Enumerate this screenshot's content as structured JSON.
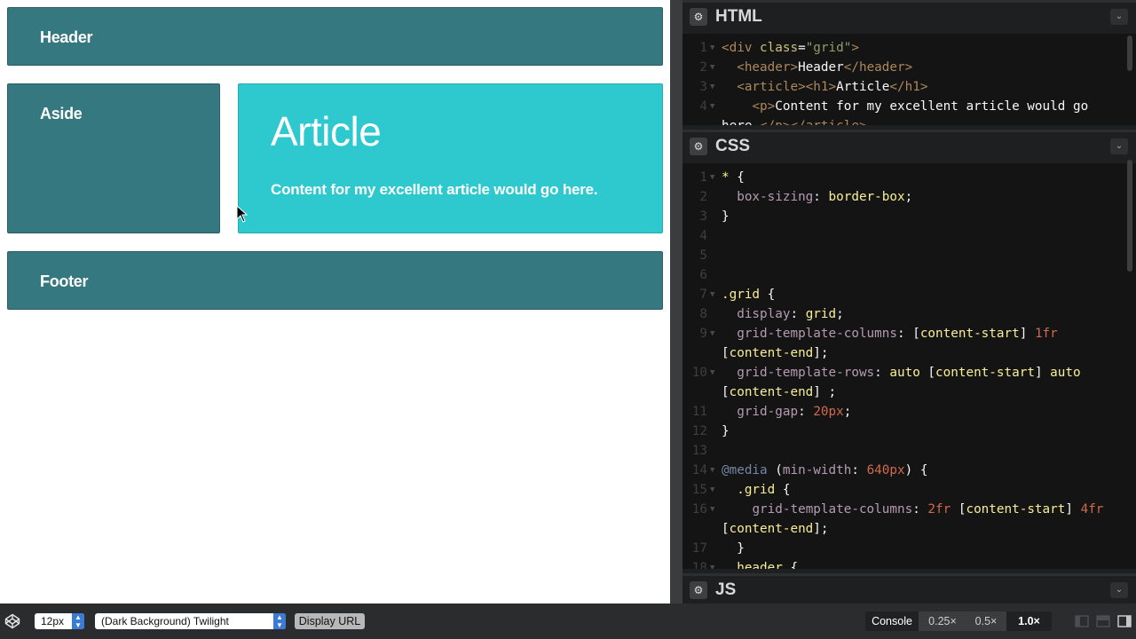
{
  "preview": {
    "header": "Header",
    "aside": "Aside",
    "article_title": "Article",
    "article_text": "Content for my excellent article would go here.",
    "footer": "Footer"
  },
  "editors": {
    "html": {
      "title": "HTML"
    },
    "css": {
      "title": "CSS"
    },
    "js": {
      "title": "JS"
    }
  },
  "html_code": [
    {
      "n": "1",
      "fold": true,
      "parts": [
        [
          "tag",
          "<div "
        ],
        [
          "atn",
          "class"
        ],
        [
          "pun",
          "="
        ],
        [
          "str",
          "\"grid\""
        ],
        [
          "tag",
          ">"
        ]
      ]
    },
    {
      "n": "2",
      "fold": true,
      "parts": [
        [
          "txt",
          "  "
        ],
        [
          "tag",
          "<header>"
        ],
        [
          "txt",
          "Header"
        ],
        [
          "tag",
          "</header>"
        ]
      ]
    },
    {
      "n": "3",
      "fold": true,
      "parts": [
        [
          "txt",
          "  "
        ],
        [
          "tag",
          "<article><h1>"
        ],
        [
          "txt",
          "Article"
        ],
        [
          "tag",
          "</h1>"
        ]
      ]
    },
    {
      "n": "4",
      "fold": true,
      "parts": [
        [
          "txt",
          "    "
        ],
        [
          "tag",
          "<p>"
        ],
        [
          "txt",
          "Content for my excellent article would go"
        ]
      ]
    },
    {
      "n": "",
      "fold": false,
      "parts": [
        [
          "txt",
          "here."
        ],
        [
          "tag",
          "</p></article>"
        ]
      ]
    }
  ],
  "css_code": [
    {
      "n": "1",
      "fold": true,
      "parts": [
        [
          "sel",
          "* "
        ],
        [
          "pun",
          "{"
        ]
      ]
    },
    {
      "n": "2",
      "fold": false,
      "parts": [
        [
          "txt",
          "  "
        ],
        [
          "prop",
          "box-sizing"
        ],
        [
          "pun",
          ": "
        ],
        [
          "val",
          "border-box"
        ],
        [
          "pun",
          ";"
        ]
      ]
    },
    {
      "n": "3",
      "fold": false,
      "parts": [
        [
          "pun",
          "}"
        ]
      ]
    },
    {
      "n": "4",
      "fold": false,
      "parts": []
    },
    {
      "n": "5",
      "fold": false,
      "parts": []
    },
    {
      "n": "6",
      "fold": false,
      "parts": []
    },
    {
      "n": "7",
      "fold": true,
      "parts": [
        [
          "sel",
          ".grid "
        ],
        [
          "pun",
          "{"
        ]
      ]
    },
    {
      "n": "8",
      "fold": false,
      "parts": [
        [
          "txt",
          "  "
        ],
        [
          "prop",
          "display"
        ],
        [
          "pun",
          ": "
        ],
        [
          "val",
          "grid"
        ],
        [
          "pun",
          ";"
        ]
      ]
    },
    {
      "n": "9",
      "fold": true,
      "parts": [
        [
          "txt",
          "  "
        ],
        [
          "prop",
          "grid-template-columns"
        ],
        [
          "pun",
          ": ["
        ],
        [
          "val",
          "content-start"
        ],
        [
          "pun",
          "] "
        ],
        [
          "num",
          "1fr"
        ]
      ]
    },
    {
      "n": "",
      "fold": false,
      "parts": [
        [
          "pun",
          "["
        ],
        [
          "val",
          "content-end"
        ],
        [
          "pun",
          "];"
        ]
      ]
    },
    {
      "n": "10",
      "fold": true,
      "parts": [
        [
          "txt",
          "  "
        ],
        [
          "prop",
          "grid-template-rows"
        ],
        [
          "pun",
          ": "
        ],
        [
          "val",
          "auto"
        ],
        [
          "pun",
          " ["
        ],
        [
          "val",
          "content-start"
        ],
        [
          "pun",
          "] "
        ],
        [
          "val",
          "auto"
        ]
      ]
    },
    {
      "n": "",
      "fold": false,
      "parts": [
        [
          "pun",
          "["
        ],
        [
          "val",
          "content-end"
        ],
        [
          "pun",
          "] ;"
        ]
      ]
    },
    {
      "n": "11",
      "fold": false,
      "parts": [
        [
          "txt",
          "  "
        ],
        [
          "prop",
          "grid-gap"
        ],
        [
          "pun",
          ": "
        ],
        [
          "num",
          "20px"
        ],
        [
          "pun",
          ";"
        ]
      ]
    },
    {
      "n": "12",
      "fold": false,
      "parts": [
        [
          "pun",
          "}"
        ]
      ]
    },
    {
      "n": "13",
      "fold": false,
      "parts": []
    },
    {
      "n": "14",
      "fold": true,
      "parts": [
        [
          "at",
          "@media"
        ],
        [
          "pun",
          " ("
        ],
        [
          "prop",
          "min-width"
        ],
        [
          "pun",
          ": "
        ],
        [
          "num",
          "640px"
        ],
        [
          "pun",
          ") {"
        ]
      ]
    },
    {
      "n": "15",
      "fold": true,
      "parts": [
        [
          "txt",
          "  "
        ],
        [
          "sel",
          ".grid "
        ],
        [
          "pun",
          "{"
        ]
      ]
    },
    {
      "n": "16",
      "fold": true,
      "parts": [
        [
          "txt",
          "    "
        ],
        [
          "prop",
          "grid-template-columns"
        ],
        [
          "pun",
          ": "
        ],
        [
          "num",
          "2fr"
        ],
        [
          "pun",
          " ["
        ],
        [
          "val",
          "content-start"
        ],
        [
          "pun",
          "] "
        ],
        [
          "num",
          "4fr"
        ]
      ]
    },
    {
      "n": "",
      "fold": false,
      "parts": [
        [
          "pun",
          "["
        ],
        [
          "val",
          "content-end"
        ],
        [
          "pun",
          "];"
        ]
      ]
    },
    {
      "n": "17",
      "fold": false,
      "parts": [
        [
          "txt",
          "  "
        ],
        [
          "pun",
          "}"
        ]
      ]
    },
    {
      "n": "18",
      "fold": true,
      "parts": [
        [
          "txt",
          "  "
        ],
        [
          "sel",
          "header "
        ],
        [
          "pun",
          "{"
        ]
      ]
    }
  ],
  "bottombar": {
    "font_size": "12px",
    "theme": "(Dark Background) Twilight",
    "display_url": "Display URL",
    "console": "Console",
    "zoom_options": [
      "0.25×",
      "0.5×",
      "1.0×"
    ]
  },
  "colors": {
    "box_dark": "#35787f",
    "box_light": "#2ec8cf",
    "editor_bg": "#141414"
  }
}
